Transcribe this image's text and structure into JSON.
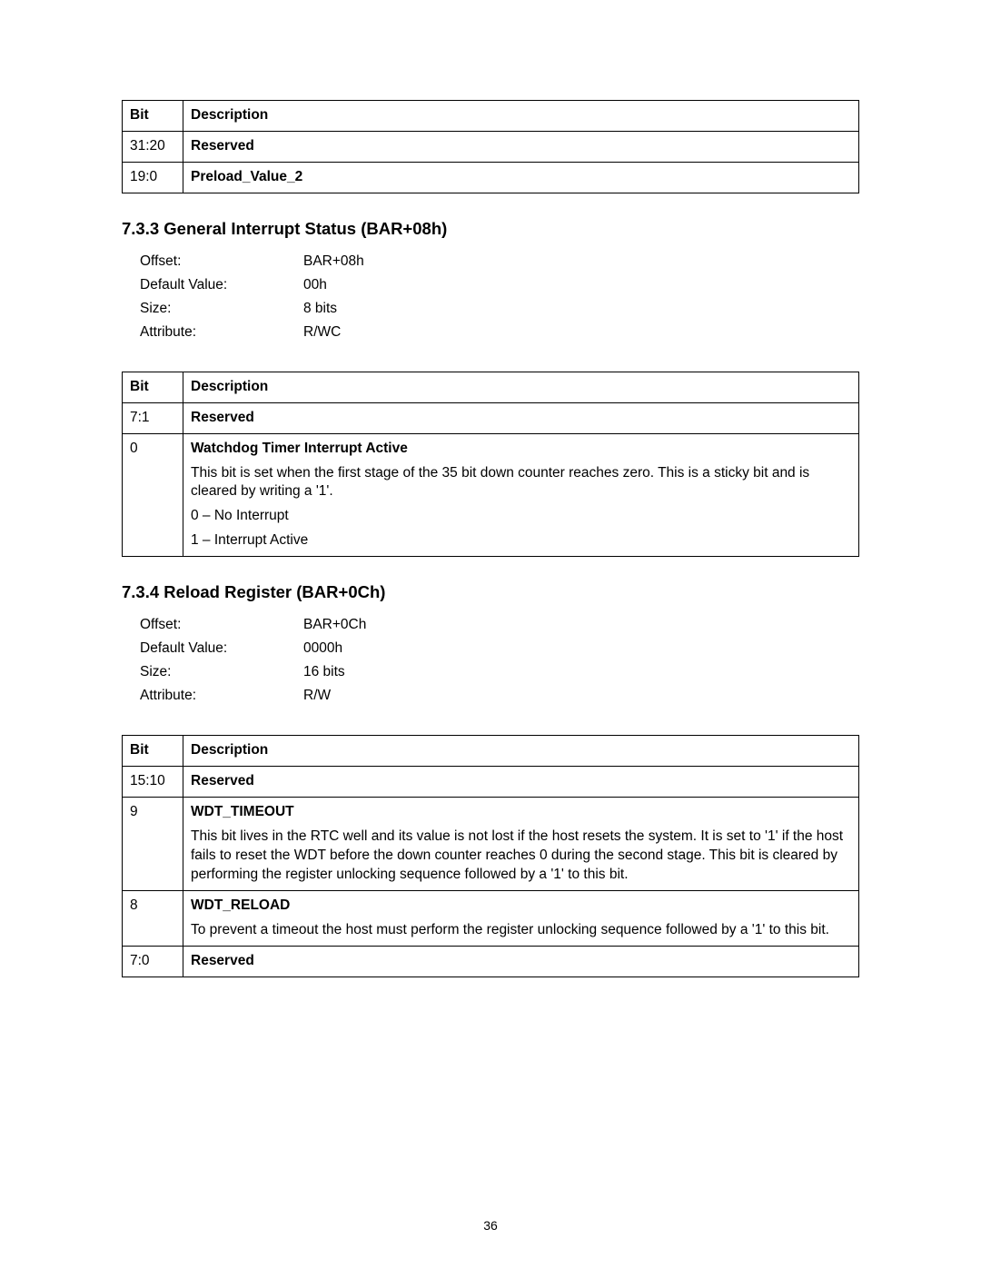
{
  "table1": {
    "header": {
      "bit": "Bit",
      "desc": "Description"
    },
    "rows": [
      {
        "bit": "31:20",
        "desc": "Reserved"
      },
      {
        "bit": "19:0",
        "desc": "Preload_Value_2"
      }
    ]
  },
  "section733": {
    "heading": "7.3.3   General Interrupt Status (BAR+08h)",
    "info": {
      "offset_label": "Offset:",
      "offset_value": "BAR+08h",
      "default_label": "Default Value:",
      "default_value": "00h",
      "size_label": "Size:",
      "size_value": "8 bits",
      "attr_label": "Attribute:",
      "attr_value": "R/WC"
    },
    "table": {
      "header": {
        "bit": "Bit",
        "desc": "Description"
      },
      "rows": [
        {
          "bit": "7:1",
          "title": "Reserved"
        },
        {
          "bit": "0",
          "title": "Watchdog Timer Interrupt Active",
          "p1": "This bit is set when the first stage of the 35 bit down counter reaches zero. This is a sticky bit and is cleared by writing a '1'.",
          "p2": "0 – No Interrupt",
          "p3": "1 – Interrupt Active"
        }
      ]
    }
  },
  "section734": {
    "heading": "7.3.4   Reload Register (BAR+0Ch)",
    "info": {
      "offset_label": "Offset:",
      "offset_value": "BAR+0Ch",
      "default_label": "Default Value:",
      "default_value": "0000h",
      "size_label": "Size:",
      "size_value": "16 bits",
      "attr_label": "Attribute:",
      "attr_value": "R/W"
    },
    "table": {
      "header": {
        "bit": "Bit",
        "desc": "Description"
      },
      "rows": [
        {
          "bit": "15:10",
          "title": "Reserved"
        },
        {
          "bit": "9",
          "title": "WDT_TIMEOUT",
          "p1": "This bit lives in the RTC well and its value is not lost if the host resets the system. It is set to '1' if the host fails to reset the WDT before the down counter reaches 0 during the second stage. This bit is cleared by performing the register unlocking sequence followed by a '1' to this bit."
        },
        {
          "bit": "8",
          "title": "WDT_RELOAD",
          "p1": "To prevent a timeout the host must perform the register unlocking sequence followed by a '1' to this bit."
        },
        {
          "bit": "7:0",
          "title": "Reserved"
        }
      ]
    }
  },
  "page_number": "36"
}
